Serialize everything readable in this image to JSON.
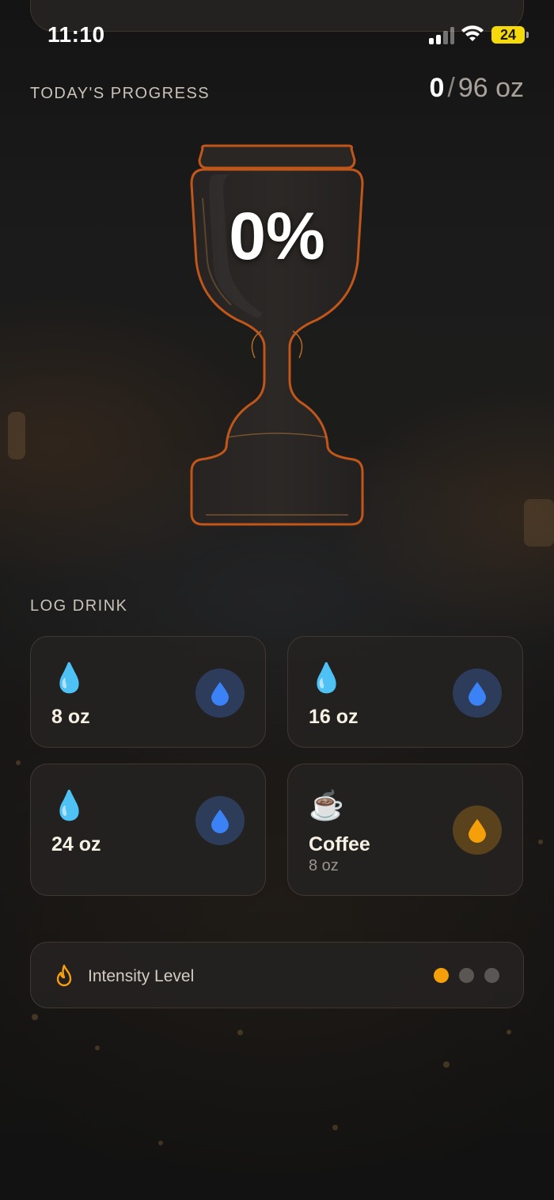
{
  "status_bar": {
    "time": "11:10",
    "battery": "24"
  },
  "progress": {
    "label": "TODAY'S PROGRESS",
    "current": "0",
    "separator": "/",
    "goal": "96 oz",
    "percent": "0%",
    "fill_fraction": 0
  },
  "log_drink": {
    "label": "LOG DRINK",
    "items": [
      {
        "emoji": "💧",
        "label": "8 oz",
        "sub": "",
        "kind": "water"
      },
      {
        "emoji": "💧",
        "label": "16 oz",
        "sub": "",
        "kind": "water"
      },
      {
        "emoji": "💧",
        "label": "24 oz",
        "sub": "",
        "kind": "water"
      },
      {
        "emoji": "☕",
        "label": "Coffee",
        "sub": "8 oz",
        "kind": "coffee"
      }
    ]
  },
  "intensity": {
    "label": "Intensity Level",
    "level": 1,
    "max_level": 3
  },
  "colors": {
    "accent": "#f5a00b",
    "water_drop": "#3b82f6",
    "trophy_outline": "#c0561a"
  }
}
